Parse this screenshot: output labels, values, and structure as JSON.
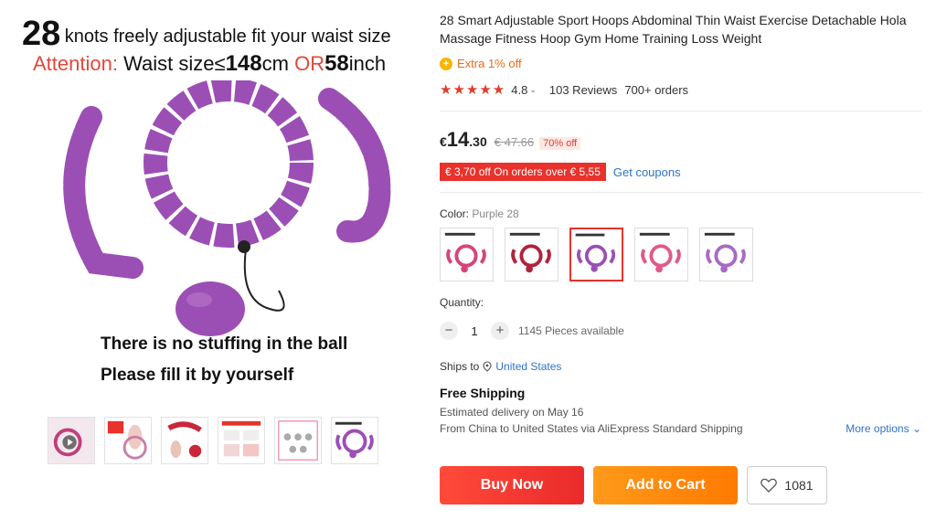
{
  "image": {
    "headline_number": "28",
    "headline_text": "knots freely adjustable fit your waist size",
    "attention_label": "Attention:",
    "attention_text": "Waist size≤",
    "attention_cm_value": "148",
    "attention_cm_unit": "cm",
    "attention_or": "OR",
    "attention_inch_value": "58",
    "attention_inch_unit": "inch",
    "caption_line1": "There is no stuffing in the ball",
    "caption_line2": "Please fill it by yourself",
    "hoop_color": "#9b4fb5",
    "thumbnails": [
      "video-thumb",
      "30-days-thumb",
      "red-hoop-thumb",
      "instructions-thumb",
      "package-thumb",
      "main-thumb"
    ]
  },
  "product": {
    "title": "28 Smart Adjustable Sport Hoops Abdominal Thin Waist Exercise Detachable Hola Massage Fitness Hoop Gym Home Training Loss Weight",
    "extra_discount": "Extra 1% off",
    "stars": "★★★★★",
    "rating": "4.8",
    "reviews": "103 Reviews",
    "orders": "700+ orders",
    "currency": "€",
    "price_int": "14",
    "price_dec": ".30",
    "old_price": "€ 47.66",
    "discount_badge": "70% off",
    "coupon_text": "€ 3,70 off On orders over € 5,55",
    "get_coupons": "Get coupons",
    "color_label": "Color:",
    "color_value": "Purple 28",
    "swatches": [
      "Pink 28",
      "Red 28",
      "Purple 28",
      "Pink 24",
      "Purple 24"
    ],
    "quantity_label": "Quantity:",
    "quantity": "1",
    "available": "1145 Pieces available",
    "ships_to_label": "Ships to",
    "ships_to": "United States",
    "free_shipping": "Free Shipping",
    "estimated": "Estimated delivery on May 16",
    "route": "From China to United States via AliExpress Standard Shipping",
    "more_options": "More options",
    "buy_now": "Buy Now",
    "add_to_cart": "Add to Cart",
    "wishlist_count": "1081"
  },
  "colors": {
    "accent_red": "#e8322b",
    "accent_orange": "#ff7a00",
    "link_blue": "#2f73c9"
  }
}
